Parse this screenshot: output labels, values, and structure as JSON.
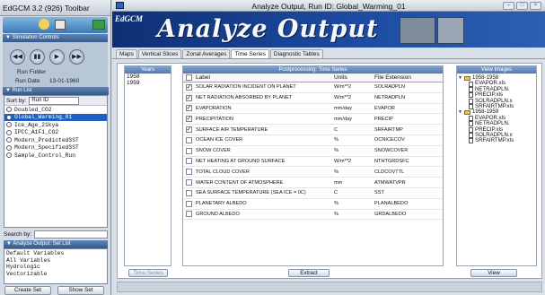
{
  "toolbar": {
    "title": "EdGCM 3.2 (926) Toolbar",
    "simulation_controls_header": "▼ Simulation Controls",
    "run_folder_label": "Run Folder",
    "run_date_label": "Run Date",
    "run_date_value": "13-01-1960",
    "run_list_header": "▼ Run List",
    "sort_by_label": "Sort by:",
    "sort_by_value": "Run ID",
    "runs": [
      "Doubled_CO2",
      "Global_Warming_01",
      "Ice_Age_21kya",
      "IPCC_A1F1_CO2",
      "Modern_PredictedSST",
      "Modern_SpecifiedSST",
      "Sample_Control_Run"
    ],
    "selected_run_index": 1,
    "search_label": "Search by:",
    "set_list_header": "▼ Analyze Output: Set List",
    "set_list": [
      "Default Variables",
      "All Variables",
      "Hydrologic",
      "Vectorizable"
    ],
    "create_set_label": "Create Set",
    "show_set_label": "Show Set"
  },
  "main": {
    "title": "Analyze Output, Run ID: Global_Warming_01",
    "window_buttons": [
      "–",
      "□",
      "×"
    ],
    "banner_brand": "EdGCM",
    "banner_title": "Analyze Output",
    "tabs": [
      "Maps",
      "Vertical Slices",
      "Zonal Averages",
      "Time Series",
      "Diagnostic Tables"
    ],
    "active_tab": "Time Series",
    "years_header": "Years",
    "years": [
      "1958",
      "1959"
    ],
    "post_header": "Postprocessing: Time Series",
    "columns": {
      "label": "Label",
      "units": "Units",
      "ext": "File Extension"
    },
    "rows": [
      {
        "label": "SOLAR RADIATION INCIDENT ON PLANET",
        "units": "W/m**2",
        "ext": "SOLRADPLN",
        "checked": true
      },
      {
        "label": "NET RADIATION ABSORBED BY PLANET",
        "units": "W/m**2",
        "ext": "NETRADPLN",
        "checked": true
      },
      {
        "label": "EVAPORATION",
        "units": "mm/day",
        "ext": "EVAPOR",
        "checked": true
      },
      {
        "label": "PRECIPITATION",
        "units": "mm/day",
        "ext": "PRECIP",
        "checked": true
      },
      {
        "label": "SURFACE AIR TEMPERATURE",
        "units": "C",
        "ext": "SRFAIRTMP",
        "checked": true
      },
      {
        "label": "OCEAN ICE COVER",
        "units": "%",
        "ext": "OCNICECOV",
        "checked": false
      },
      {
        "label": "SNOW COVER",
        "units": "%",
        "ext": "SNOWCOVER",
        "checked": false
      },
      {
        "label": "NET HEATING AT GROUND SURFACE",
        "units": "W/m**2",
        "ext": "NTHTGRDSFC",
        "checked": false
      },
      {
        "label": "TOTAL CLOUD COVER",
        "units": "%",
        "ext": "CLDCOVTTL",
        "checked": false
      },
      {
        "label": "WATER CONTENT OF ATMOSPHERE",
        "units": "mm",
        "ext": "ATMWATVPR",
        "checked": false
      },
      {
        "label": "SEA SURFACE TEMPERATURE (SEA ICE = 0C)",
        "units": "C",
        "ext": "SST",
        "checked": false
      },
      {
        "label": "PLANETARY ALBEDO",
        "units": "%",
        "ext": "PLANALBEDO",
        "checked": false
      },
      {
        "label": "GROUND ALBEDO",
        "units": "%",
        "ext": "GRDALBEDO",
        "checked": false
      }
    ],
    "view_header": "View Images",
    "tree": [
      {
        "folder": "1958-1958",
        "files": [
          "EVAPOR.xls",
          "NETRADPLN.",
          "PRECIP.xls",
          "SOLRADPLN.x",
          "SRFAIRTMP.xls"
        ]
      },
      {
        "folder": "1958-1959",
        "files": [
          "EVAPOR.xls",
          "NETRADPLN.",
          "PRECIP.xls",
          "SOLRADPLN.x",
          "SRFAIRTMP.xls"
        ]
      }
    ],
    "time_series_btn": "Time Series",
    "extract_btn": "Extract",
    "view_btn": "View"
  },
  "colors": {
    "accent": "#1f5fc4",
    "banner": "#1e4da4",
    "header_blue": "#5379b0"
  }
}
